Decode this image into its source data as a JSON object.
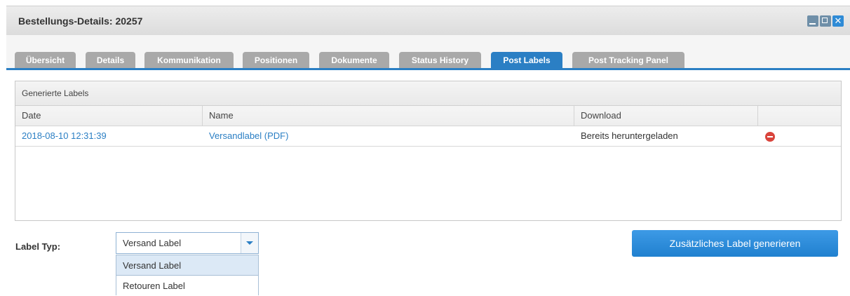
{
  "window": {
    "title": "Bestellungs-Details: 20257",
    "controls": {
      "minimize": "minimize-icon",
      "maximize": "maximize-icon",
      "close": "✕"
    }
  },
  "tabs": [
    {
      "label": "Übersicht",
      "active": false
    },
    {
      "label": "Details",
      "active": false
    },
    {
      "label": "Kommunikation",
      "active": false
    },
    {
      "label": "Positionen",
      "active": false
    },
    {
      "label": "Dokumente",
      "active": false
    },
    {
      "label": "Status History",
      "active": false
    },
    {
      "label": "Post Labels",
      "active": true
    },
    {
      "label": "Post Tracking Panel",
      "active": false
    }
  ],
  "panel": {
    "title": "Generierte Labels",
    "columns": [
      "Date",
      "Name",
      "Download",
      ""
    ],
    "rows": [
      {
        "date": "2018-08-10 12:31:39",
        "name": "Versandlabel (PDF)",
        "download": "Bereits heruntergeladen",
        "action_icon": "remove-icon"
      }
    ]
  },
  "form": {
    "label_typ": "Label Typ:",
    "select_value": "Versand Label",
    "options": [
      "Versand Label",
      "Retouren Label"
    ],
    "generate_button": "Zusätzliches Label generieren"
  },
  "colors": {
    "accent": "#2b7fc4",
    "tab_inactive": "#a9a9a9",
    "danger": "#d9443c"
  }
}
